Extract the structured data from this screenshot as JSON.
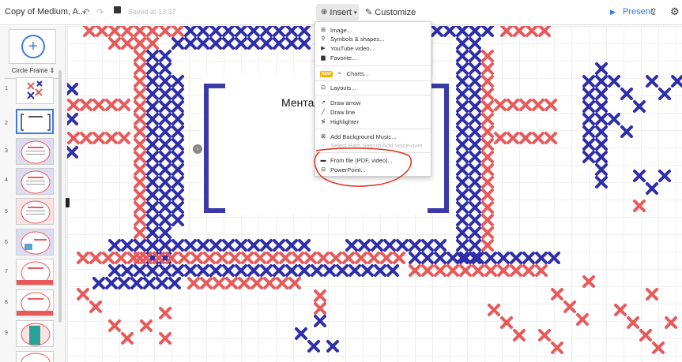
{
  "toolbar": {
    "title": "Copy of Medium, A...",
    "saved_status": "Saved at 13:37",
    "insert_label": "Insert",
    "customize_label": "Customize",
    "present_label": "Present"
  },
  "left_panel": {
    "frame_label": "Circle Frame",
    "slide_numbers": [
      "1",
      "2",
      "3",
      "4",
      "5",
      "6",
      "7",
      "8",
      "9"
    ]
  },
  "canvas": {
    "slide_text": "Ментал"
  },
  "insert_menu": {
    "items": [
      {
        "label": "Image...",
        "icon": "image-icon"
      },
      {
        "label": "Symbols & shapes...",
        "icon": "pin-icon"
      },
      {
        "label": "YouTube video...",
        "icon": "youtube-icon"
      },
      {
        "label": "Favorite...",
        "icon": "favorite-icon"
      },
      {
        "label": "Charts...",
        "icon": "chart-icon",
        "badge": "NEW"
      },
      {
        "label": "Layouts...",
        "icon": "layouts-icon"
      },
      {
        "label": "Draw arrow",
        "icon": "arrow-icon"
      },
      {
        "label": "Draw line",
        "icon": "line-icon"
      },
      {
        "label": "Highlighter",
        "icon": "highlighter-icon"
      },
      {
        "label": "Add Background Music...",
        "icon": "music-icon"
      },
      {
        "label": "Select Path Step to Add Voice-over",
        "icon": "mic-icon",
        "disabled": true
      },
      {
        "label": "From file (PDF, video)...",
        "icon": "folder-icon"
      },
      {
        "label": "PowerPoint...",
        "icon": "powerpoint-icon"
      }
    ]
  },
  "colors": {
    "red": "#e85a5a",
    "blue": "#2e2eaa",
    "accent": "#2a7de1",
    "annotation": "#e0301e"
  }
}
